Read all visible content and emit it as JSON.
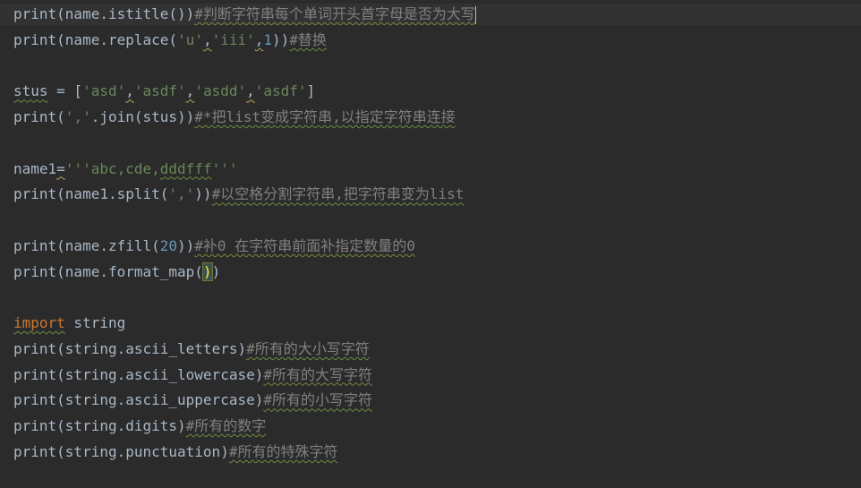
{
  "editor": {
    "lines": [
      {
        "segments": [
          {
            "t": "print(name.istitle())",
            "c": "ident"
          },
          {
            "t": "#判断字符串每个单词开头首字母是否为大写",
            "c": "cmt squiggle"
          }
        ],
        "current": true
      },
      {
        "segments": [
          {
            "t": "print(name.replace(",
            "c": "ident"
          },
          {
            "t": "'u'",
            "c": "str"
          },
          {
            "t": ",",
            "c": "ident squiggle-warn"
          },
          {
            "t": "'iii'",
            "c": "str"
          },
          {
            "t": ",",
            "c": "ident squiggle-warn"
          },
          {
            "t": "1",
            "c": "num"
          },
          {
            "t": "))",
            "c": "ident"
          },
          {
            "t": "#替换",
            "c": "cmt squiggle"
          }
        ]
      },
      {
        "segments": []
      },
      {
        "segments": [
          {
            "t": "stus",
            "c": "ident squiggle"
          },
          {
            "t": " = [",
            "c": "ident"
          },
          {
            "t": "'asd'",
            "c": "str"
          },
          {
            "t": ",",
            "c": "ident squiggle-warn"
          },
          {
            "t": "'asdf'",
            "c": "str"
          },
          {
            "t": ",",
            "c": "ident squiggle-warn"
          },
          {
            "t": "'asdd'",
            "c": "str"
          },
          {
            "t": ",",
            "c": "ident squiggle-warn"
          },
          {
            "t": "'asdf'",
            "c": "str"
          },
          {
            "t": "]",
            "c": "ident"
          }
        ]
      },
      {
        "segments": [
          {
            "t": "print(",
            "c": "ident"
          },
          {
            "t": "','",
            "c": "str"
          },
          {
            "t": ".join(stus))",
            "c": "ident"
          },
          {
            "t": "#*把list变成字符串,以指定字符串连接",
            "c": "cmt squiggle"
          }
        ]
      },
      {
        "segments": []
      },
      {
        "segments": [
          {
            "t": "name1",
            "c": "ident"
          },
          {
            "t": "=",
            "c": "ident squiggle-warn"
          },
          {
            "t": "'''abc,cde,",
            "c": "str"
          },
          {
            "t": "dddfff",
            "c": "str squiggle"
          },
          {
            "t": "'''",
            "c": "str"
          }
        ]
      },
      {
        "segments": [
          {
            "t": "print(name1.split(",
            "c": "ident"
          },
          {
            "t": "','",
            "c": "str"
          },
          {
            "t": "))",
            "c": "ident"
          },
          {
            "t": "#以空格分割字符串,把字符串变为list",
            "c": "cmt squiggle"
          }
        ]
      },
      {
        "segments": []
      },
      {
        "segments": [
          {
            "t": "print(name.zfill(",
            "c": "ident"
          },
          {
            "t": "20",
            "c": "num"
          },
          {
            "t": "))",
            "c": "ident"
          },
          {
            "t": "#补0 在字符串前面补指定数量的0",
            "c": "cmt squiggle"
          }
        ]
      },
      {
        "segments": [
          {
            "t": "print(name.format_map(",
            "c": "ident"
          },
          {
            "t": ")",
            "c": "ident brace-match"
          },
          {
            "t": ")",
            "c": "ident"
          }
        ]
      },
      {
        "segments": []
      },
      {
        "segments": [
          {
            "t": "import",
            "c": "kw squiggle"
          },
          {
            "t": " string",
            "c": "ident"
          }
        ]
      },
      {
        "segments": [
          {
            "t": "print(string.ascii_letters)",
            "c": "ident"
          },
          {
            "t": "#所有的大小写字符",
            "c": "cmt squiggle"
          }
        ]
      },
      {
        "segments": [
          {
            "t": "print(string.ascii_lowercase)",
            "c": "ident"
          },
          {
            "t": "#所有的大写字符",
            "c": "cmt squiggle"
          }
        ]
      },
      {
        "segments": [
          {
            "t": "print(string.ascii_uppercase)",
            "c": "ident"
          },
          {
            "t": "#所有的小写字符",
            "c": "cmt squiggle"
          }
        ]
      },
      {
        "segments": [
          {
            "t": "print(string.digits)",
            "c": "ident"
          },
          {
            "t": "#所有的数字",
            "c": "cmt squiggle"
          }
        ]
      },
      {
        "segments": [
          {
            "t": "print(string.punctuation)",
            "c": "ident"
          },
          {
            "t": "#所有的特殊字符",
            "c": "cmt squiggle"
          }
        ]
      }
    ]
  },
  "colors": {
    "background": "#2b2b2b",
    "current_line": "#323232",
    "keyword": "#cc7832",
    "number": "#6897bb",
    "string": "#6a8759",
    "comment": "#808080",
    "identifier": "#a9b7c6"
  }
}
